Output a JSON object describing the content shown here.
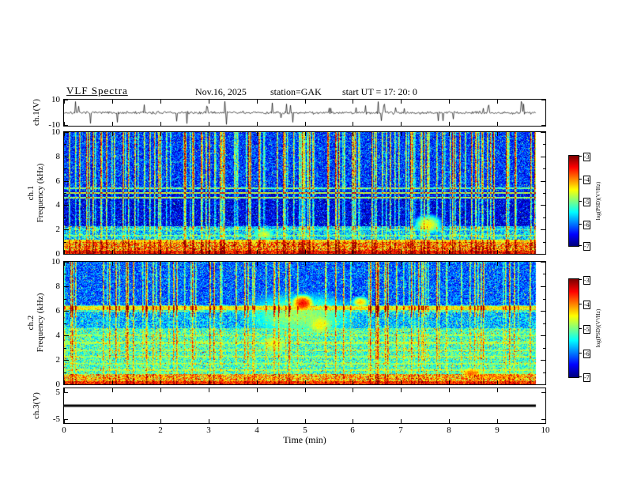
{
  "header": {
    "title": "VLF Spectra",
    "date": "Nov.16, 2025",
    "station": "station=GAK",
    "start_ut": "start UT =  17: 20: 0"
  },
  "colors": {
    "background": "#ffffff",
    "frame": "#000000",
    "trace": "#000000",
    "colormap": "jet"
  },
  "x_axis": {
    "label": "Time (min)",
    "min": 0,
    "max": 10,
    "ticks": [
      0,
      1,
      2,
      3,
      4,
      5,
      6,
      7,
      8,
      9,
      10
    ],
    "data_end_min": 9.8
  },
  "chart_data": [
    {
      "id": "ch1-waveform",
      "type": "line",
      "ylabel": "ch.1(V)",
      "ylim": [
        -10,
        10
      ],
      "yticks": [
        10,
        -10
      ],
      "description": "Broadband VLF electric-field time series; ~±1 V noise floor with dense impulsive sferic spikes reaching ±9 V over the 0–9.8 min record.",
      "noise_amplitude_v": 1.0,
      "spike_probability": 0.06,
      "spike_max_v": 9,
      "seed": 7
    },
    {
      "id": "ch1-spectrogram",
      "type": "heatmap",
      "channel": "ch.1",
      "ylabel": "Frequency (kHz)",
      "ylim": [
        0,
        10
      ],
      "xlim": [
        0,
        10
      ],
      "yticks": [
        0,
        2,
        4,
        6,
        8,
        10
      ],
      "value_range": [
        -7,
        -3
      ],
      "colorbar": {
        "label": "log(PSD)(V²/Hz)",
        "min": -7,
        "max": -3,
        "ticks": [
          -3,
          -4,
          -5,
          -6,
          -7
        ]
      },
      "description": "Dense vertical sferic striations across the full band; intense broadband power (−4 to −3) below 1 kHz; quiet ~−6.6 background at 2–5 kHz; narrowband lines near 1.0, 1.5, 4.6, 5.0 and 5.4 kHz.",
      "bands": [
        {
          "f0": 0.0,
          "f1": 0.25,
          "v": -3.6,
          "n": 0.5
        },
        {
          "f0": 0.25,
          "f1": 0.95,
          "v": -4.1,
          "n": 0.9
        },
        {
          "f0": 0.95,
          "f1": 1.15,
          "v": -4.6,
          "n": 0.5
        },
        {
          "f0": 1.15,
          "f1": 2.3,
          "v": -5.7,
          "n": 0.7
        },
        {
          "f0": 2.3,
          "f1": 5.2,
          "v": -6.6,
          "n": 0.5
        },
        {
          "f0": 5.2,
          "f1": 10.01,
          "v": -6.3,
          "n": 0.55
        }
      ],
      "lines": [
        {
          "f": 1.0,
          "v": -4.6,
          "w": 0.09
        },
        {
          "f": 1.5,
          "v": -5.2,
          "w": 0.07
        },
        {
          "f": 2.0,
          "v": -5.5,
          "w": 0.06
        },
        {
          "f": 4.6,
          "v": -5.0,
          "w": 0.08
        },
        {
          "f": 5.0,
          "v": -4.8,
          "w": 0.09
        },
        {
          "f": 5.4,
          "v": -5.1,
          "w": 0.06
        }
      ],
      "blobs": [
        {
          "t": 7.55,
          "f": 2.4,
          "v": -4.5,
          "rt": 0.25,
          "rf": 0.7
        },
        {
          "t": 4.15,
          "f": 1.6,
          "v": -4.7,
          "rt": 0.2,
          "rf": 0.5
        }
      ],
      "stripe_density": 0.17,
      "stripe_profile": [
        0.45,
        0.8,
        1.12
      ],
      "seed": 11
    },
    {
      "id": "ch2-spectrogram",
      "type": "heatmap",
      "channel": "ch.2",
      "ylabel": "Frequency (kHz)",
      "ylim": [
        0,
        10
      ],
      "xlim": [
        0,
        10
      ],
      "yticks": [
        0,
        2,
        4,
        6,
        8,
        10
      ],
      "value_range": [
        -7,
        -3
      ],
      "colorbar": {
        "label": "log(PSD)(V²/Hz)",
        "min": -7,
        "max": -3,
        "ticks": [
          -3,
          -4,
          -5,
          -6,
          -7
        ]
      },
      "description": "Diffuse green/cyan power (−5.5 to −4.6) below ~4.5 kHz with stacked narrowband lines; bright emission line near 6.2 kHz with warm blob near t≈5 min; bluer background above 6.5 kHz crossed by sferic striations; bright broadband band below 1 kHz.",
      "bands": [
        {
          "f0": 0.0,
          "f1": 0.25,
          "v": -3.7,
          "n": 0.5
        },
        {
          "f0": 0.25,
          "f1": 0.85,
          "v": -4.3,
          "n": 0.8
        },
        {
          "f0": 0.85,
          "f1": 4.6,
          "v": -5.25,
          "n": 0.65
        },
        {
          "f0": 4.6,
          "f1": 5.9,
          "v": -5.8,
          "n": 0.6
        },
        {
          "f0": 5.9,
          "f1": 6.45,
          "v": -5.3,
          "n": 0.6
        },
        {
          "f0": 6.45,
          "f1": 10.01,
          "v": -6.15,
          "n": 0.55
        }
      ],
      "lines": [
        {
          "f": 1.15,
          "v": -4.9,
          "w": 0.08
        },
        {
          "f": 1.7,
          "v": -5.0,
          "w": 0.07
        },
        {
          "f": 2.25,
          "v": -4.95,
          "w": 0.08
        },
        {
          "f": 2.8,
          "v": -5.0,
          "w": 0.07
        },
        {
          "f": 3.4,
          "v": -4.9,
          "w": 0.08
        },
        {
          "f": 4.0,
          "v": -5.05,
          "w": 0.07
        },
        {
          "f": 6.2,
          "v": -4.5,
          "w": 0.16
        }
      ],
      "blobs": [
        {
          "t": 4.95,
          "f": 6.6,
          "v": -3.5,
          "rt": 0.18,
          "rf": 0.55
        },
        {
          "t": 5.3,
          "f": 4.9,
          "v": -4.5,
          "rt": 0.3,
          "rf": 0.9
        },
        {
          "t": 4.35,
          "f": 3.3,
          "v": -4.6,
          "rt": 0.3,
          "rf": 0.8
        },
        {
          "t": 8.45,
          "f": 0.9,
          "v": -3.9,
          "rt": 0.2,
          "rf": 0.4
        },
        {
          "t": 6.15,
          "f": 6.7,
          "v": -4.3,
          "rt": 0.15,
          "rf": 0.4
        },
        {
          "t": 9.0,
          "f": 0.6,
          "v": -4.2,
          "rt": 0.8,
          "rf": 0.35
        },
        {
          "t": 4.9,
          "f": 5.6,
          "v": -4.9,
          "rt": 1.2,
          "rf": 1.8
        }
      ],
      "stripe_density": 0.13,
      "stripe_profile": [
        0.3,
        0.5,
        0.95
      ],
      "seed": 23
    },
    {
      "id": "ch3-waveform",
      "type": "line",
      "ylabel": "ch.3(V)",
      "ylim": [
        -6.5,
        6.5
      ],
      "yticks": [
        5,
        -5
      ],
      "description": "Flat dead channel: constant 0 V thick trace from 0 to 9.8 min.",
      "flat_value_v": 0,
      "seed": 3
    }
  ]
}
